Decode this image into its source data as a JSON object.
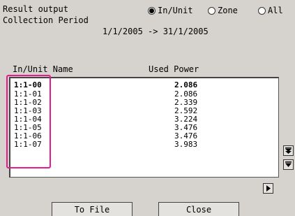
{
  "header": {
    "result_output_label": "Result output",
    "collection_period_label": "Collection Period",
    "period_range": "1/1/2005 -> 31/1/2005"
  },
  "radio_options": [
    {
      "label": "In/Unit",
      "selected": true
    },
    {
      "label": "Zone",
      "selected": false
    },
    {
      "label": "All",
      "selected": false
    }
  ],
  "table": {
    "columns": [
      "In/Unit Name",
      "Used Power"
    ],
    "rows": [
      {
        "unit": "1:1-00",
        "power": "2.086"
      },
      {
        "unit": "1:1-01",
        "power": "2.086"
      },
      {
        "unit": "1:1-02",
        "power": "2.339"
      },
      {
        "unit": "1:1-03",
        "power": "2.592"
      },
      {
        "unit": "1:1-04",
        "power": "3.224"
      },
      {
        "unit": "1:1-05",
        "power": "3.476"
      },
      {
        "unit": "1:1-06",
        "power": "3.476"
      },
      {
        "unit": "1:1-07",
        "power": "3.983"
      }
    ]
  },
  "buttons": {
    "to_file": "To File",
    "close": "Close"
  },
  "icons": {
    "page_down": "double-arrow-down-icon",
    "scroll_down": "arrow-down-icon",
    "scroll_right": "arrow-right-icon"
  },
  "colors": {
    "highlight": "#e8198c",
    "background": "#d6d3ce"
  }
}
